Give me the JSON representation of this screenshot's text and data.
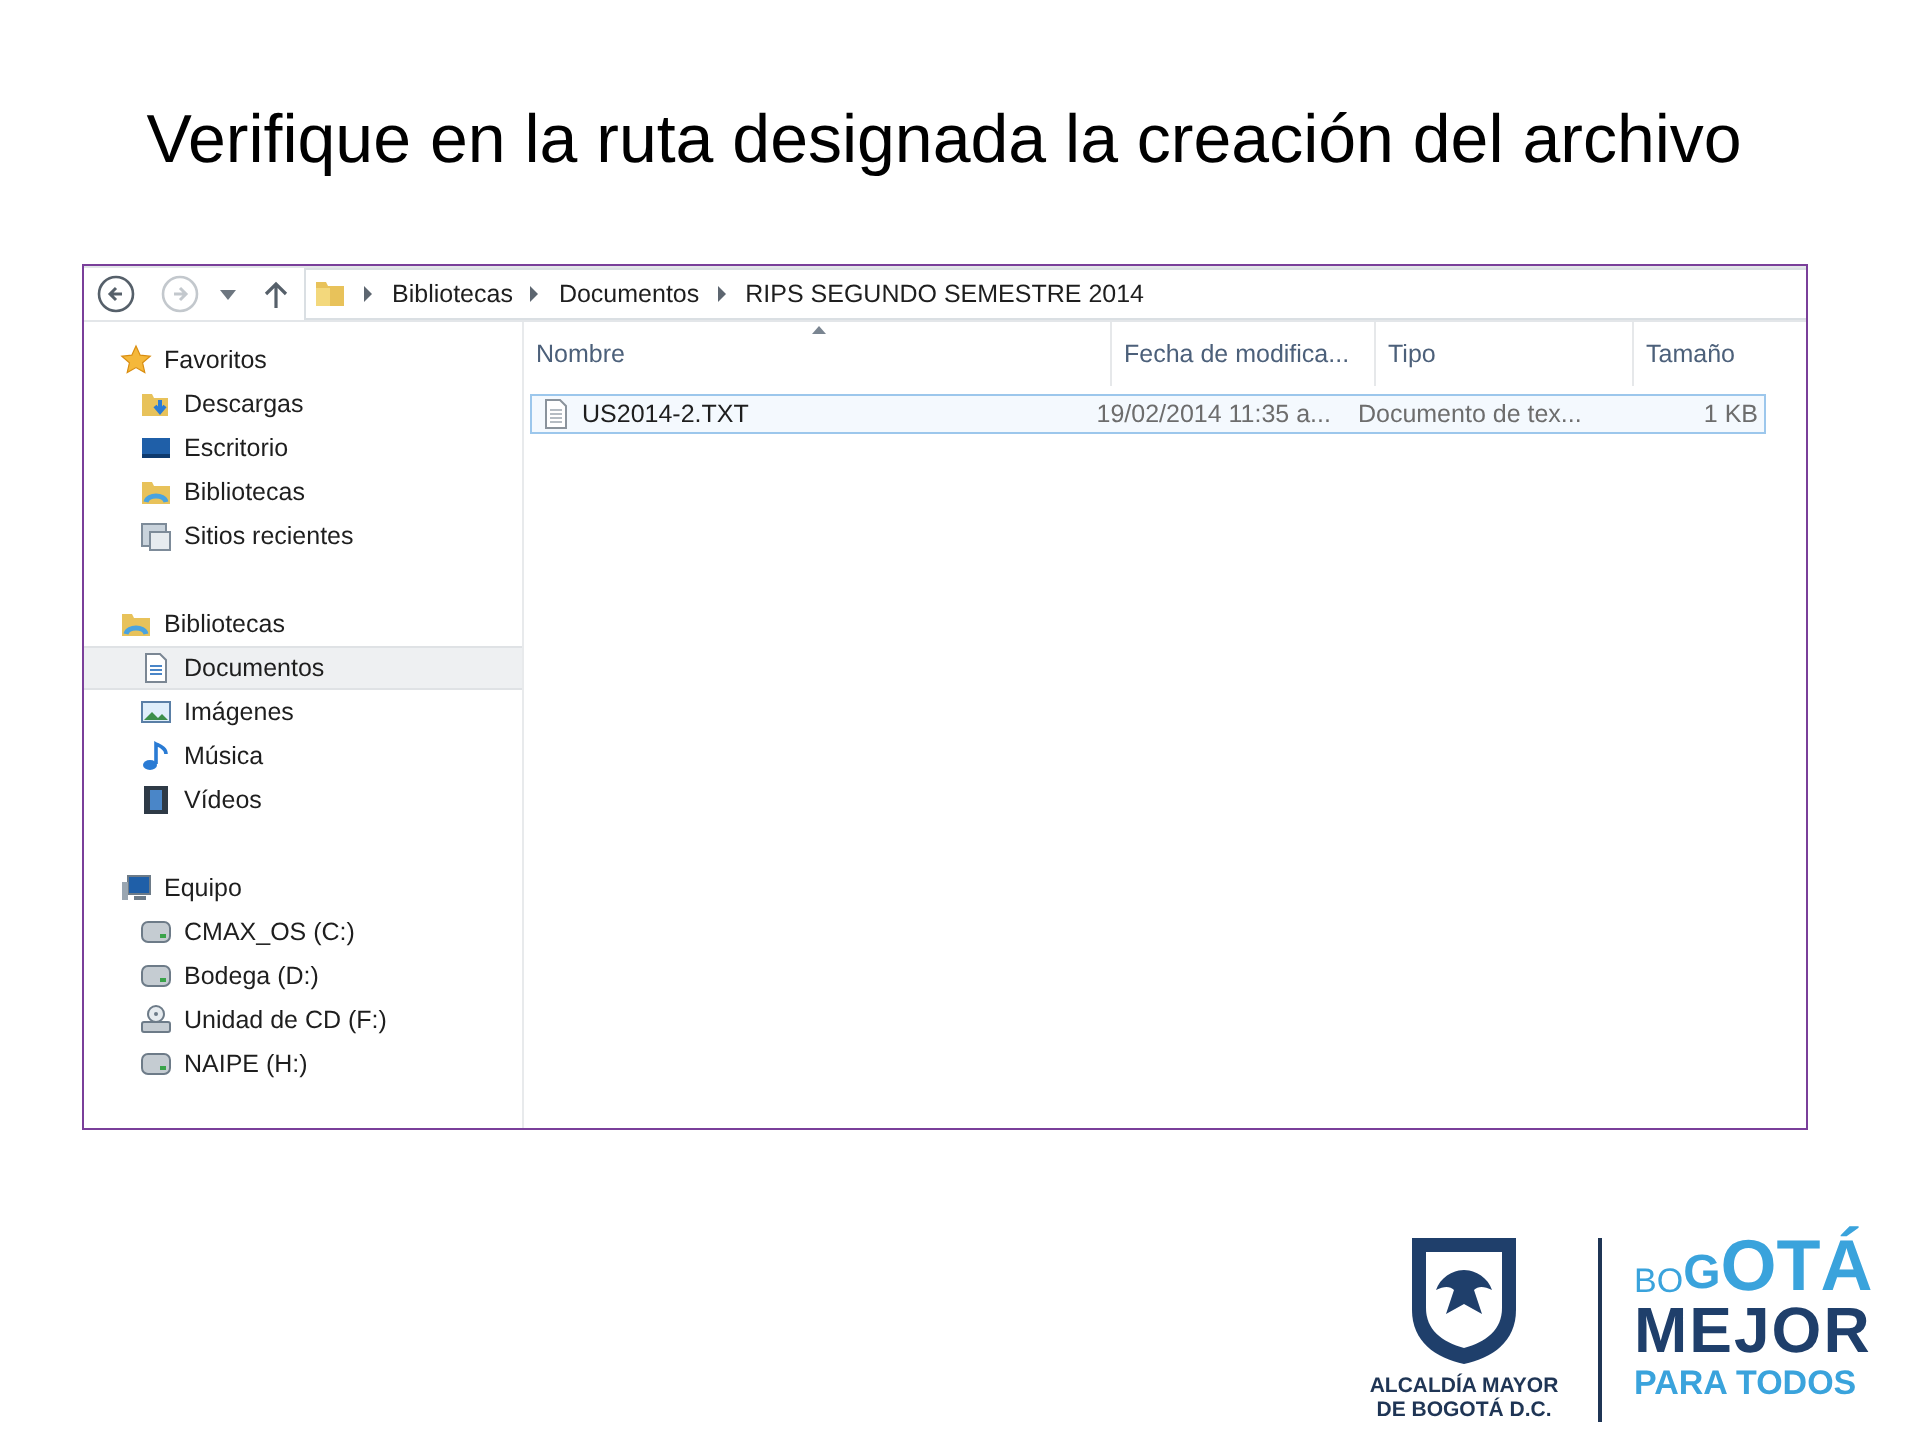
{
  "slide": {
    "title": "Verifique en la ruta designada la creación del archivo"
  },
  "explorer": {
    "nav": {
      "back": {
        "disabled": false
      },
      "forward": {
        "disabled": true
      }
    },
    "breadcrumb": [
      "Bibliotecas",
      "Documentos",
      "RIPS SEGUNDO SEMESTRE 2014"
    ],
    "sidebar": [
      {
        "label": "Favoritos",
        "kind": "favorites",
        "selected": false,
        "children": [
          {
            "label": "Descargas",
            "kind": "downloads",
            "selected": false
          },
          {
            "label": "Escritorio",
            "kind": "desktop",
            "selected": false
          },
          {
            "label": "Bibliotecas",
            "kind": "libraries",
            "selected": false
          },
          {
            "label": "Sitios recientes",
            "kind": "recent",
            "selected": false
          }
        ]
      },
      {
        "label": "Bibliotecas",
        "kind": "libraries",
        "selected": false,
        "children": [
          {
            "label": "Documentos",
            "kind": "document",
            "selected": true
          },
          {
            "label": "Imágenes",
            "kind": "images",
            "selected": false
          },
          {
            "label": "Música",
            "kind": "music",
            "selected": false
          },
          {
            "label": "Vídeos",
            "kind": "videos",
            "selected": false
          }
        ]
      },
      {
        "label": "Equipo",
        "kind": "computer",
        "selected": false,
        "children": [
          {
            "label": "CMAX_OS (C:)",
            "kind": "drive",
            "selected": false
          },
          {
            "label": "Bodega (D:)",
            "kind": "drive",
            "selected": false
          },
          {
            "label": "Unidad de CD (F:)",
            "kind": "cd",
            "selected": false
          },
          {
            "label": "NAIPE (H:)",
            "kind": "drive",
            "selected": false
          }
        ]
      }
    ],
    "table": {
      "columns": [
        {
          "label": "Nombre",
          "sorted": true
        },
        {
          "label": "Fecha de modifica...",
          "sorted": false
        },
        {
          "label": "Tipo",
          "sorted": false
        },
        {
          "label": "Tamaño",
          "sorted": false
        }
      ],
      "rows": [
        {
          "selected": true,
          "cells": [
            "US2014-2.TXT",
            "19/02/2014 11:35 a...",
            "Documento de tex...",
            "1 KB"
          ]
        }
      ]
    }
  },
  "logos": {
    "city": [
      "ALCALDÍA MAYOR",
      "DE BOGOTÁ D.C."
    ],
    "slogan": [
      "BOGOTÁ",
      "MEJOR",
      "PARA TODOS"
    ]
  }
}
